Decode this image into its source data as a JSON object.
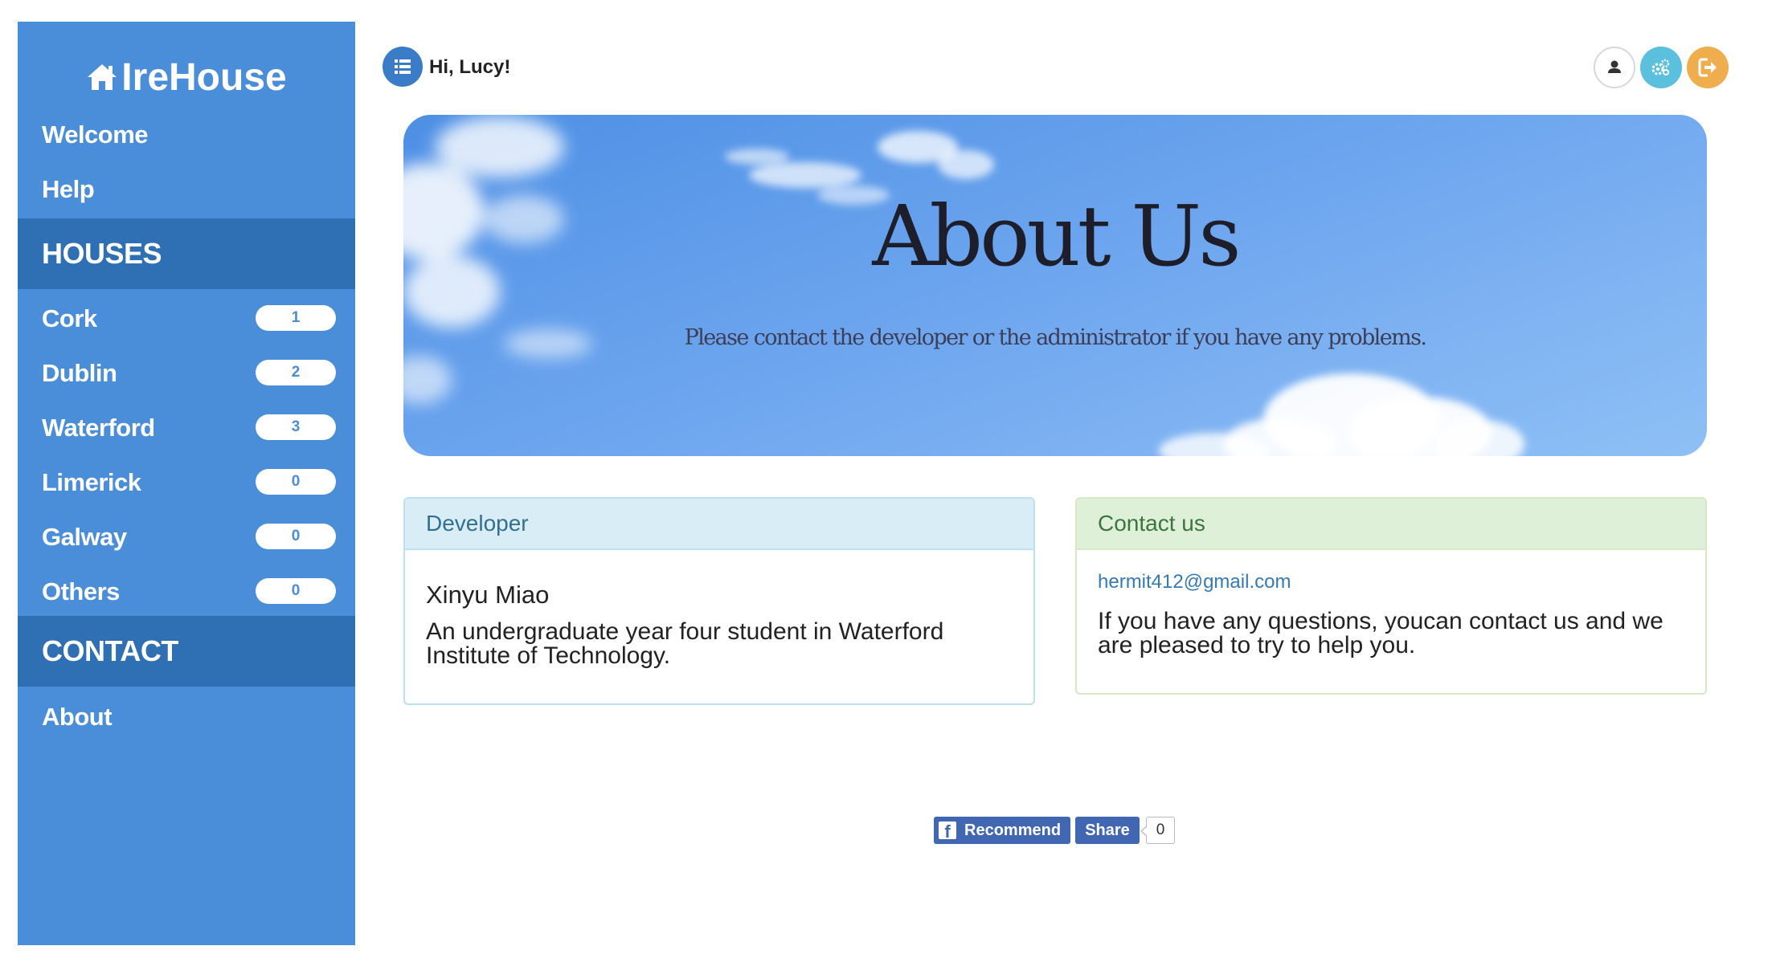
{
  "brand": {
    "name": "IreHouse",
    "icon": "home-icon"
  },
  "nav": {
    "welcome": "Welcome",
    "help": "Help"
  },
  "houses_section": {
    "header": "HOUSES",
    "items": [
      {
        "label": "Cork",
        "count": "1"
      },
      {
        "label": "Dublin",
        "count": "2"
      },
      {
        "label": "Waterford",
        "count": "3"
      },
      {
        "label": "Limerick",
        "count": "0"
      },
      {
        "label": "Galway",
        "count": "0"
      },
      {
        "label": "Others",
        "count": "0"
      }
    ]
  },
  "contact_section": {
    "header": "CONTACT",
    "about": "About"
  },
  "topbar": {
    "greeting": "Hi, Lucy!",
    "buttons": [
      {
        "icon": "user-icon",
        "color": "#ffffff"
      },
      {
        "icon": "gears-icon",
        "color": "#5bc0de"
      },
      {
        "icon": "sign-out-icon",
        "color": "#f0ad4e"
      }
    ]
  },
  "hero": {
    "title": "About Us",
    "subtitle": "Please contact the developer or the administrator if you have any problems."
  },
  "developer_panel": {
    "heading": "Developer",
    "name": "Xinyu Miao",
    "description": "An undergraduate year four student in Waterford Institute of Technology."
  },
  "contact_panel": {
    "heading": "Contact us",
    "email": "hermit412@gmail.com",
    "text": "If you have any questions, youcan contact us and we are pleased to try to help you."
  },
  "facebook": {
    "recommend": "Recommend",
    "share": "Share",
    "count": "0"
  },
  "colors": {
    "sidebar": "#4a8dd8",
    "section_header": "#2f6fb3",
    "developer_heading_bg": "#d9edf7",
    "contact_heading_bg": "#dff0d8",
    "facebook_blue": "#4267b2"
  }
}
